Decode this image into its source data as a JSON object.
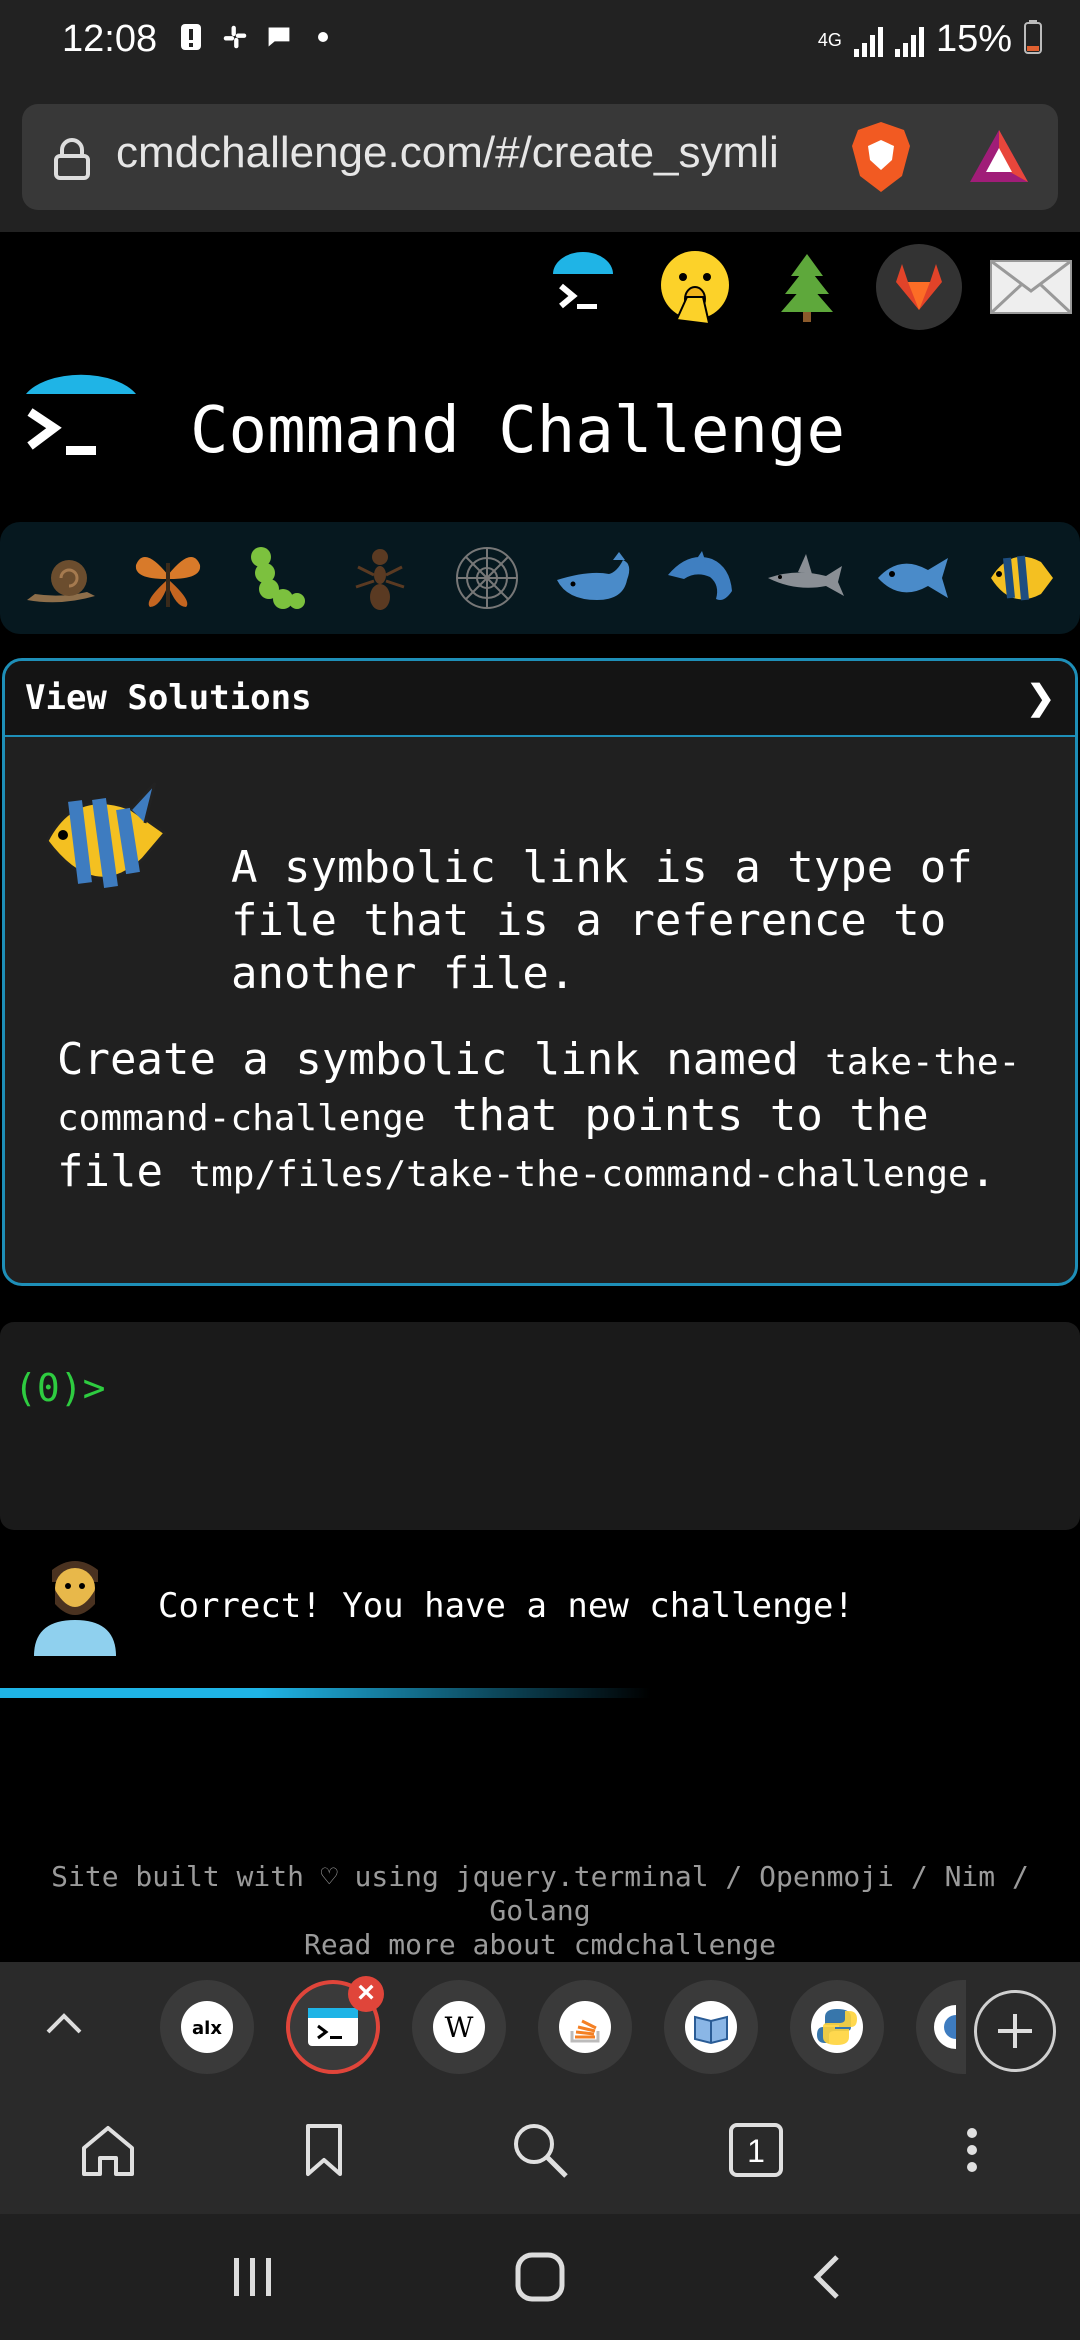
{
  "status_bar": {
    "time": "12:08",
    "network": "4G",
    "battery": "15%",
    "icons": [
      "alert-icon",
      "slack-icon",
      "message-icon",
      "dot-icon"
    ]
  },
  "address_bar": {
    "url": "cmdchallenge.com/#/create_symli"
  },
  "header_icons": [
    "terminal-logo-icon",
    "face-hand-emoji-icon",
    "tree-icon",
    "gitlab-icon",
    "mail-icon"
  ],
  "page": {
    "title": "Command Challenge",
    "animals": [
      "snail",
      "butterfly",
      "caterpillar",
      "ant",
      "spider-web",
      "whale",
      "dolphin",
      "shark",
      "fish",
      "tropical-fish"
    ],
    "solutions_label": "View Solutions",
    "description_intro": "A symbolic link is a type of file that is a reference to another file.",
    "task_part1": "Create a symbolic link named ",
    "task_code1": "take-the-command-challenge",
    "task_part2": " that points to the file ",
    "task_code2": "tmp/files/take-the-command-challenge",
    "task_part3": ".",
    "prompt": "(0)>",
    "feedback": "Correct! You have a new challenge!",
    "footer_line1": "Site built with ♡ using jquery.terminal / Openmoji / Nim / Golang",
    "footer_line2": "Read more about cmdchallenge"
  },
  "tab_strip": {
    "tabs": [
      "alx-tab",
      "cmdchallenge-tab",
      "wikipedia-tab",
      "stackoverflow-tab",
      "book-tab",
      "python-tab",
      "partial-tab"
    ],
    "active_index": 1
  },
  "toolbar": {
    "tab_count": "1"
  },
  "colors": {
    "accent": "#1e8fb8",
    "prompt": "#2ecc40",
    "background": "#000000"
  }
}
